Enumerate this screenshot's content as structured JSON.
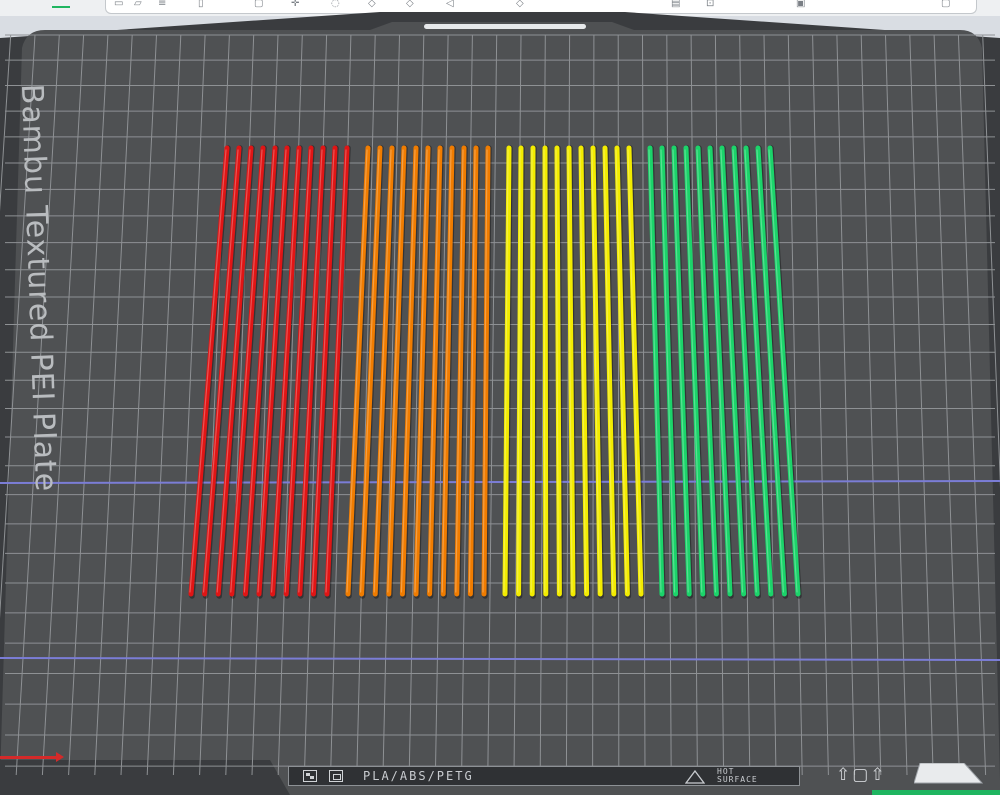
{
  "plate": {
    "name": "Bambu Textured PEI Plate",
    "material_label": "PLA/ABS/PETG",
    "warning_line1": "HOT",
    "warning_line2": "SURFACE"
  },
  "toolbar": {
    "icons": [
      "menu-icon",
      "add-icon",
      "cube-icon",
      "layers-icon",
      "orient-icon",
      "arrange-icon",
      "move-icon",
      "rotate-icon",
      "scale-icon",
      "cut-icon",
      "support-paint-icon",
      "seam-icon",
      "text-icon",
      "measure-icon",
      "assembly-icon"
    ]
  },
  "colors": {
    "bed": "#4f5153",
    "bed_border": "#2f3134",
    "grid": "#8e9194",
    "guide_line": "#7b7dd6",
    "strand_groups": [
      "#e01515",
      "#f07c00",
      "#f3ec00",
      "#1bd46a"
    ]
  },
  "model": {
    "strand_groups": 4,
    "strands_per_group": 11
  }
}
